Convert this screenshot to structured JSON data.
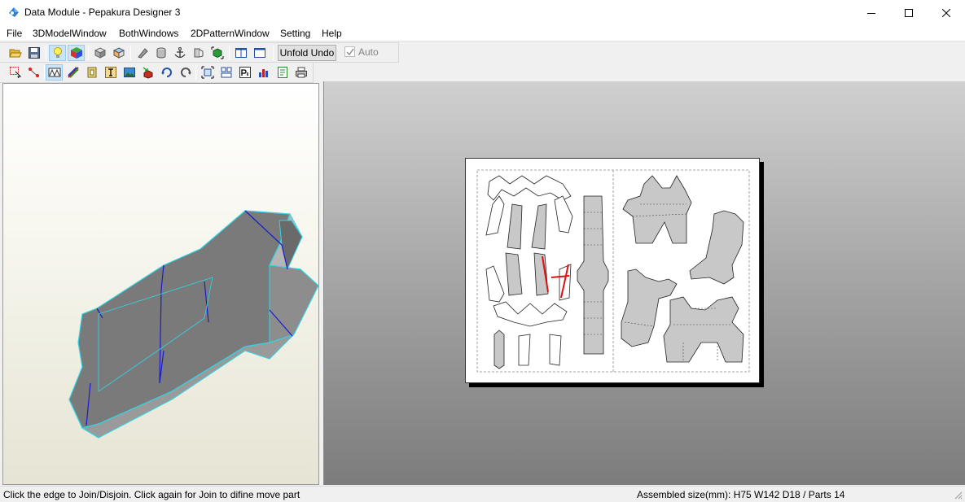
{
  "window": {
    "title": "Data Module - Pepakura Designer 3"
  },
  "menu": [
    "File",
    "3DModelWindow",
    "BothWindows",
    "2DPatternWindow",
    "Setting",
    "Help"
  ],
  "toolbar": {
    "unfold_undo_label": "Unfold Undo",
    "auto_label": "Auto"
  },
  "status": {
    "left": "Click the edge to Join/Disjoin. Click again for Join to difine move part",
    "right": "Assembled size(mm): H75 W142 D18 / Parts 14"
  },
  "colors": {
    "accent_cyan": "#2fd6e6",
    "fold_blue": "#1a1ad0",
    "cut_red": "#e01010",
    "model_face": "#7a7a7a",
    "part_fill": "#c8c8c8"
  }
}
